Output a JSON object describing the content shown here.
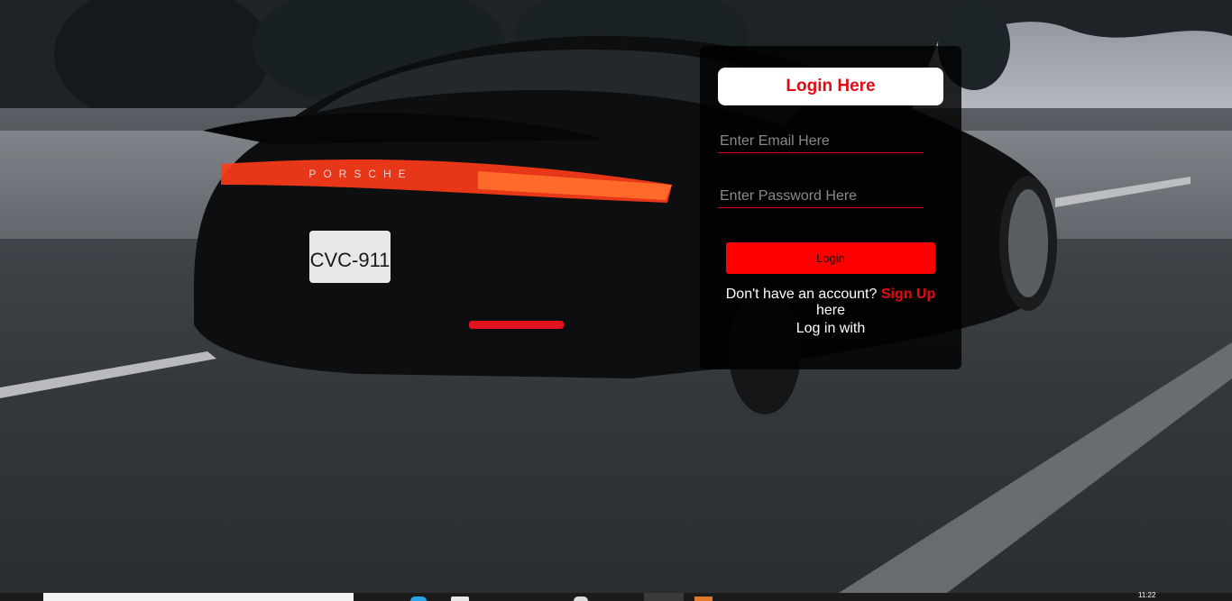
{
  "login": {
    "title": "Login Here",
    "email_placeholder": "Enter Email Here",
    "password_placeholder": "Enter Password Here",
    "button_label": "Login",
    "signup_prompt": "Don't have an account?",
    "signup_link": "Sign Up",
    "signup_suffix": "here",
    "login_with": "Log in with"
  },
  "background": {
    "plate_text": "CVC-911",
    "brand_text": "PORSCHE"
  },
  "taskbar": {
    "clock": "11:22"
  },
  "colors": {
    "accent": "#e50914",
    "button": "#ff0000",
    "card": "#000000"
  }
}
